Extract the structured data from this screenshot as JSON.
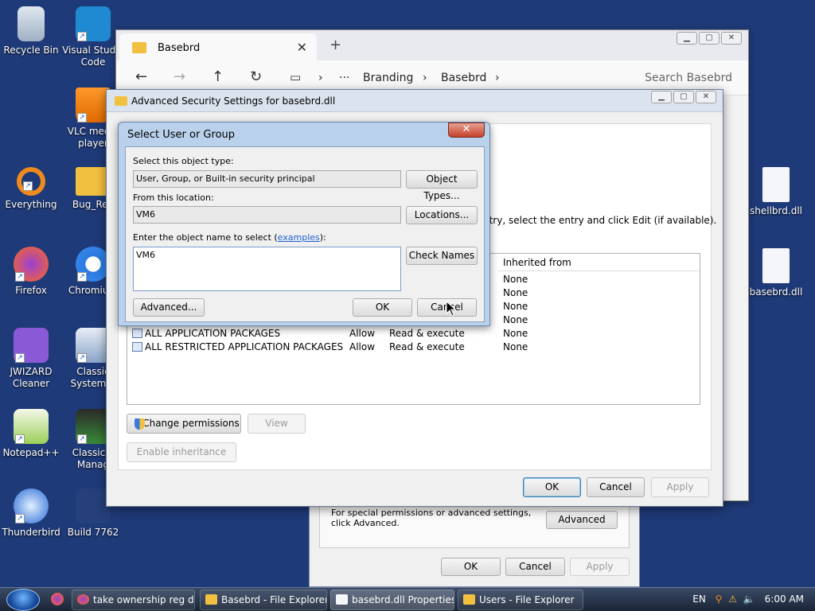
{
  "desktop": {
    "icons": [
      {
        "label": "Recycle Bin"
      },
      {
        "label": "Visual Studio Code"
      },
      {
        "label": "VLC media player"
      },
      {
        "label": "Everything"
      },
      {
        "label": "Bug_Rep"
      },
      {
        "label": "Firefox"
      },
      {
        "label": "Chromium"
      },
      {
        "label": "JWIZARD Cleaner"
      },
      {
        "label": "Classic System C"
      },
      {
        "label": "Notepad++"
      },
      {
        "label": "Classic T Manag"
      },
      {
        "label": "Thunderbird"
      },
      {
        "label": "Build 7762"
      },
      {
        "label": "shellbrd.dll"
      },
      {
        "label": "basebrd.dll"
      }
    ]
  },
  "explorer": {
    "tab_title": "Basebrd",
    "breadcrumb": [
      "Branding",
      "Basebrd"
    ],
    "search_placeholder": "Search Basebrd"
  },
  "properties": {
    "advanced_text": "For special permissions or advanced settings, click Advanced.",
    "advanced_label": "Advanced",
    "ok_label": "OK",
    "cancel_label": "Cancel",
    "apply_label": "Apply"
  },
  "advanced_security": {
    "title": "Advanced Security Settings for basebrd.dll",
    "instruction": "ntry, select the entry and click Edit (if available).",
    "column_inherited": "Inherited from",
    "entries": [
      {
        "principal": "",
        "access_type": "",
        "access": "",
        "inherited": "None"
      },
      {
        "principal": "",
        "access_type": "",
        "access": "",
        "inherited": "None"
      },
      {
        "principal": "",
        "access_type": "",
        "access": "",
        "inherited": "None"
      },
      {
        "principal": "",
        "access_type": "",
        "access": "",
        "inherited": "None"
      },
      {
        "principal": "ALL APPLICATION PACKAGES",
        "access_type": "Allow",
        "access": "Read & execute",
        "inherited": "None"
      },
      {
        "principal": "ALL RESTRICTED APPLICATION PACKAGES",
        "access_type": "Allow",
        "access": "Read & execute",
        "inherited": "None"
      }
    ],
    "change_permissions_label": "Change permissions",
    "view_label": "View",
    "enable_inheritance_label": "Enable inheritance",
    "ok_label": "OK",
    "cancel_label": "Cancel",
    "apply_label": "Apply"
  },
  "select_user": {
    "title": "Select User or Group",
    "object_type_label": "Select this object type:",
    "object_type_value": "User, Group, or Built-in security principal",
    "object_types_button": "Object Types...",
    "location_label": "From this location:",
    "location_value": "VM6",
    "locations_button": "Locations...",
    "enter_name_label_pre": "Enter the object name to select (",
    "examples_link": "examples",
    "enter_name_label_post": "):",
    "name_value": "VM6",
    "check_names_button": "Check Names",
    "advanced_button": "Advanced...",
    "ok_button": "OK",
    "cancel_button": "Cancel"
  },
  "taskbar": {
    "items": [
      {
        "label": "take ownership reg d..."
      },
      {
        "label": "Basebrd - File Explorer"
      },
      {
        "label": "basebrd.dll Properties"
      },
      {
        "label": "Users - File Explorer"
      }
    ],
    "language": "EN",
    "time": "6:00 AM"
  }
}
